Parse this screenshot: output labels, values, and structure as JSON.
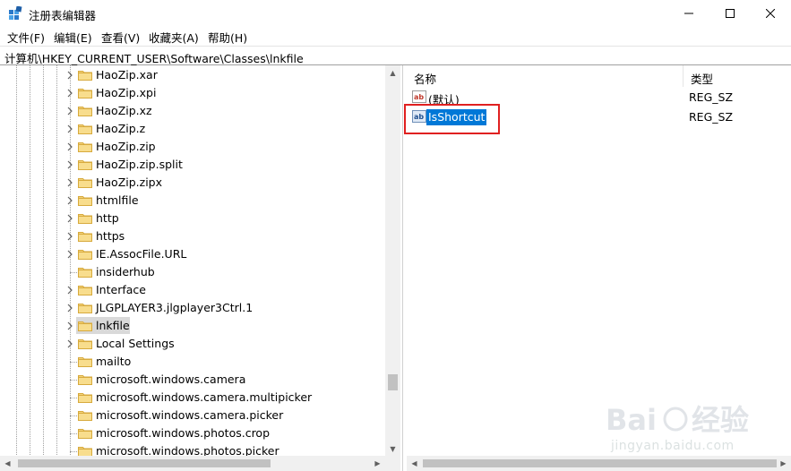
{
  "window": {
    "title": "注册表编辑器"
  },
  "menu": [
    "文件(F)",
    "编辑(E)",
    "查看(V)",
    "收藏夹(A)",
    "帮助(H)"
  ],
  "address": "计算机\\HKEY_CURRENT_USER\\Software\\Classes\\lnkfile",
  "tree": [
    {
      "label": "HaoZip.xar",
      "expandable": true
    },
    {
      "label": "HaoZip.xpi",
      "expandable": true
    },
    {
      "label": "HaoZip.xz",
      "expandable": true
    },
    {
      "label": "HaoZip.z",
      "expandable": true
    },
    {
      "label": "HaoZip.zip",
      "expandable": true
    },
    {
      "label": "HaoZip.zip.split",
      "expandable": true
    },
    {
      "label": "HaoZip.zipx",
      "expandable": true
    },
    {
      "label": "htmlfile",
      "expandable": true
    },
    {
      "label": "http",
      "expandable": true
    },
    {
      "label": "https",
      "expandable": true
    },
    {
      "label": "IE.AssocFile.URL",
      "expandable": true
    },
    {
      "label": "insiderhub",
      "expandable": false
    },
    {
      "label": "Interface",
      "expandable": true
    },
    {
      "label": "JLGPLAYER3.jlgplayer3Ctrl.1",
      "expandable": true
    },
    {
      "label": "lnkfile",
      "expandable": true,
      "selected": true
    },
    {
      "label": "Local Settings",
      "expandable": true
    },
    {
      "label": "mailto",
      "expandable": false
    },
    {
      "label": "microsoft.windows.camera",
      "expandable": false
    },
    {
      "label": "microsoft.windows.camera.multipicker",
      "expandable": false
    },
    {
      "label": "microsoft.windows.camera.picker",
      "expandable": false
    },
    {
      "label": "microsoft.windows.photos.crop",
      "expandable": false
    },
    {
      "label": "microsoft.windows.photos.picker",
      "expandable": false
    }
  ],
  "values_pane": {
    "columns": {
      "name": "名称",
      "type": "类型"
    },
    "rows": [
      {
        "name": "(默认)",
        "type": "REG_SZ",
        "icon": "ab-string-icon"
      },
      {
        "name": "IsShortcut",
        "type": "REG_SZ",
        "icon": "ab-string-icon",
        "selected": true
      }
    ]
  },
  "watermark": {
    "text": "jingyan.baidu.com",
    "logo": "Baidu经验"
  },
  "colors": {
    "selection": "#0078d7",
    "highlight_box": "#e02020",
    "folder": "#f3d27a"
  }
}
